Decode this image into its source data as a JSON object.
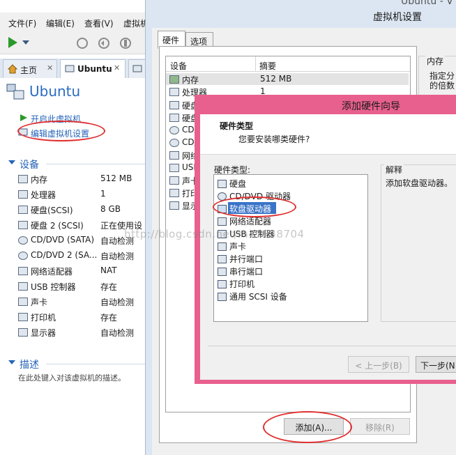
{
  "menu": [
    "文件(F)",
    "编辑(E)",
    "查看(V)",
    "虚拟机"
  ],
  "tabs": {
    "home": "主页",
    "vm": "Ubuntu"
  },
  "vm": {
    "title": "Ubuntu"
  },
  "actions": {
    "power_on": "开启此虚拟机",
    "edit_settings": "编辑虚拟机设置"
  },
  "devices_section": {
    "title": "设备",
    "items": [
      {
        "name": "内存",
        "value": "512 MB",
        "icon": "memory-icon"
      },
      {
        "name": "处理器",
        "value": "1",
        "icon": "cpu-icon"
      },
      {
        "name": "硬盘(SCSI)",
        "value": "8 GB",
        "icon": "disk-icon"
      },
      {
        "name": "硬盘 2 (SCSI)",
        "value": "正在使用设",
        "icon": "disk-icon"
      },
      {
        "name": "CD/DVD (SATA)",
        "value": "自动检测",
        "icon": "cd-icon"
      },
      {
        "name": "CD/DVD 2 (SA...",
        "value": "自动检测",
        "icon": "cd-icon"
      },
      {
        "name": "网络适配器",
        "value": "NAT",
        "icon": "network-icon"
      },
      {
        "name": "USB 控制器",
        "value": "存在",
        "icon": "usb-icon"
      },
      {
        "name": "声卡",
        "value": "自动检测",
        "icon": "sound-icon"
      },
      {
        "name": "打印机",
        "value": "存在",
        "icon": "printer-icon"
      },
      {
        "name": "显示器",
        "value": "自动检测",
        "icon": "display-icon"
      }
    ]
  },
  "description_section": {
    "title": "描述",
    "placeholder": "在此处键入对该虚拟机的描述。"
  },
  "settings": {
    "title": "虚拟机设置",
    "title_prev": "Ubuntu - V",
    "tabs": [
      "硬件",
      "选项"
    ],
    "col_device": "设备",
    "col_summary": "摘要",
    "rows": [
      {
        "name": "内存",
        "summary": "512 MB"
      },
      {
        "name": "处理器",
        "summary": "1"
      },
      {
        "name": "硬盘",
        "summary": ""
      },
      {
        "name": "硬盘",
        "summary": ""
      },
      {
        "name": "CD/",
        "summary": ""
      },
      {
        "name": "CD/",
        "summary": ""
      },
      {
        "name": "网络",
        "summary": ""
      },
      {
        "name": "USB",
        "summary": ""
      },
      {
        "name": "声卡",
        "summary": ""
      },
      {
        "name": "打印",
        "summary": ""
      },
      {
        "name": "显示",
        "summary": ""
      }
    ],
    "memory_group": {
      "title": "内存",
      "line1": "指定分",
      "line2": "的倍数"
    },
    "add_button": "添加(A)...",
    "remove_button": "移除(R)"
  },
  "wizard": {
    "title": "添加硬件向导",
    "heading": "硬件类型",
    "subheading": "您要安装哪类硬件?",
    "list_label": "硬件类型:",
    "items": [
      {
        "label": "硬盘",
        "icon": "disk-icon"
      },
      {
        "label": "CD/DVD 驱动器",
        "icon": "cd-icon"
      },
      {
        "label": "软盘驱动器",
        "icon": "floppy-icon"
      },
      {
        "label": "网络适配器",
        "icon": "network-icon"
      },
      {
        "label": "USB 控制器",
        "icon": "usb-icon"
      },
      {
        "label": "声卡",
        "icon": "sound-icon"
      },
      {
        "label": "并行端口",
        "icon": "parallel-port-icon"
      },
      {
        "label": "串行端口",
        "icon": "serial-port-icon"
      },
      {
        "label": "打印机",
        "icon": "printer-icon"
      },
      {
        "label": "通用 SCSI 设备",
        "icon": "scsi-icon"
      }
    ],
    "selected": "软盘驱动器",
    "explain_label": "解释",
    "explain_text": "添加软盘驱动器。",
    "back_button": "< 上一步(B)",
    "next_button": "下一步(N"
  },
  "watermark": "http://blog.csdn.net/m47838704",
  "colors": {
    "link": "#2464b8",
    "selection": "#3a74c8",
    "wizard_frame": "#e8608e",
    "annotation": "#e03030"
  }
}
